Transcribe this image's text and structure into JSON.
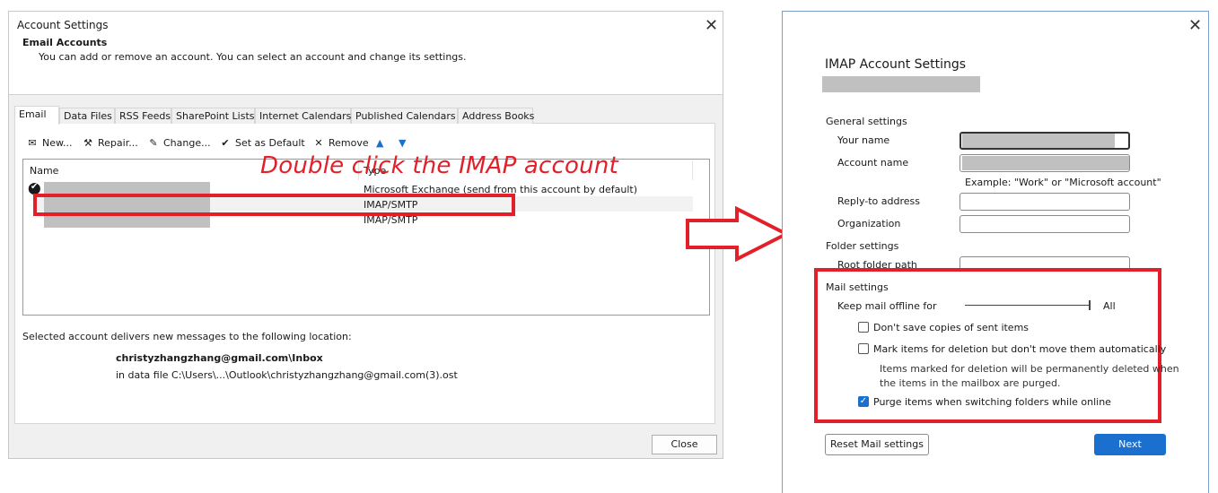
{
  "left_dialog": {
    "title": "Account Settings",
    "header_title": "Email Accounts",
    "header_subtitle": "You can add or remove an account. You can select an account and change its settings.",
    "tabs": [
      "Email",
      "Data Files",
      "RSS Feeds",
      "SharePoint Lists",
      "Internet Calendars",
      "Published Calendars",
      "Address Books"
    ],
    "toolbar": {
      "new_label": "New...",
      "repair_label": "Repair...",
      "change_label": "Change...",
      "set_default_label": "Set as Default",
      "remove_label": "Remove"
    },
    "list": {
      "col_name": "Name",
      "col_type": "Type",
      "rows": [
        {
          "type": "Microsoft Exchange (send from this account by default)"
        },
        {
          "type": "IMAP/SMTP"
        },
        {
          "type": "IMAP/SMTP"
        }
      ]
    },
    "delivery_label": "Selected account delivers new messages to the following location:",
    "delivery_folder": "christyzhangzhang@gmail.com\\Inbox",
    "delivery_file": "in data file C:\\Users\\...\\Outlook\\christyzhangzhang@gmail.com(3).ost",
    "close_label": "Close"
  },
  "annotation": {
    "text": "Double click the IMAP account",
    "color": "#e2202a"
  },
  "right_dialog": {
    "title": "IMAP Account Settings",
    "general_settings": "General settings",
    "your_name_label": "Your name",
    "account_name_label": "Account name",
    "example_text": "Example: \"Work\" or \"Microsoft account\"",
    "reply_to_label": "Reply-to address",
    "organization_label": "Organization",
    "folder_settings": "Folder settings",
    "root_folder_label": "Root folder path",
    "mail_settings": "Mail settings",
    "keep_offline_label": "Keep mail offline for",
    "keep_offline_value": "All",
    "chk_dont_save": "Don't save copies of sent items",
    "chk_mark_deletion": "Mark items for deletion but don't move them automatically",
    "mark_deletion_note_1": "Items marked for deletion will be permanently deleted when",
    "mark_deletion_note_2": "the items in the mailbox are purged.",
    "chk_purge": "Purge items when switching folders while online",
    "chk_purge_checked": true,
    "reset_label": "Reset Mail settings",
    "next_label": "Next"
  },
  "colors": {
    "accent": "#1a6fcf",
    "annotation_red": "#e2202a"
  }
}
